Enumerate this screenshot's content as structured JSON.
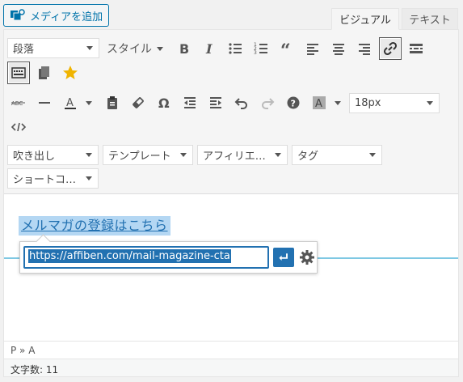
{
  "media_button": {
    "label": "メディアを追加",
    "icon": "add-media-icon"
  },
  "tabs": {
    "visual": "ビジュアル",
    "text": "テキスト"
  },
  "toolbar": {
    "format_select": "段落",
    "styles_label": "スタイル",
    "fontsize_select": "18px",
    "row4": [
      "吹き出し",
      "テンプレート",
      "アフィリエ…",
      "タグ"
    ],
    "row5": [
      "ショートコ…"
    ]
  },
  "content": {
    "link_text": "メルマガの登録はこちら",
    "url_value": "https://affiben.com/mail-magazine-cta"
  },
  "status": {
    "path": "P » A",
    "wordcount": "文字数: 11"
  },
  "colors": {
    "accent": "#2271b1",
    "highlight": "#b4d7f3",
    "star": "#f0b400"
  }
}
